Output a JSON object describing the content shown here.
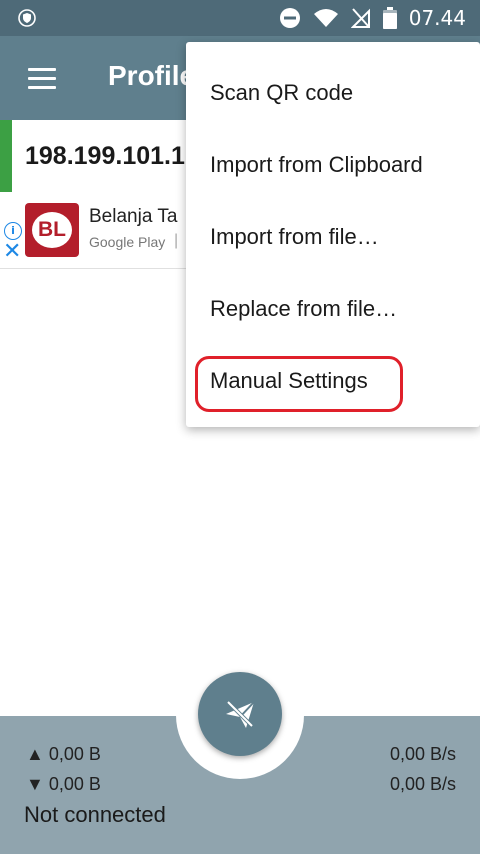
{
  "status_bar": {
    "time": "07.44",
    "icons": [
      "vpn-shield-icon",
      "do-not-disturb-icon",
      "wifi-icon",
      "no-sim-icon",
      "battery-icon"
    ]
  },
  "app_bar": {
    "title": "Profiles",
    "menu_icon": "hamburger-menu-icon",
    "color": "#5f7f8d"
  },
  "profile": {
    "ip": "198.199.101.1",
    "accent_color": "#3ca044"
  },
  "ad": {
    "logo_text": "BL",
    "title": "Belanja Ta",
    "store": "Google Play",
    "separator": "|"
  },
  "menu": {
    "items": [
      {
        "label": "Scan QR code"
      },
      {
        "label": "Import from Clipboard"
      },
      {
        "label": "Import from file…"
      },
      {
        "label": "Replace from file…"
      },
      {
        "label": "Manual Settings"
      }
    ],
    "highlight_color": "#e0202a"
  },
  "bottom": {
    "upload_total": "▲ 0,00 B",
    "download_total": "▼ 0,00 B",
    "upload_rate": "0,00 B/s",
    "download_rate": "0,00 B/s",
    "connection_status": "Not connected",
    "fab_icon": "paper-plane-off-icon"
  }
}
